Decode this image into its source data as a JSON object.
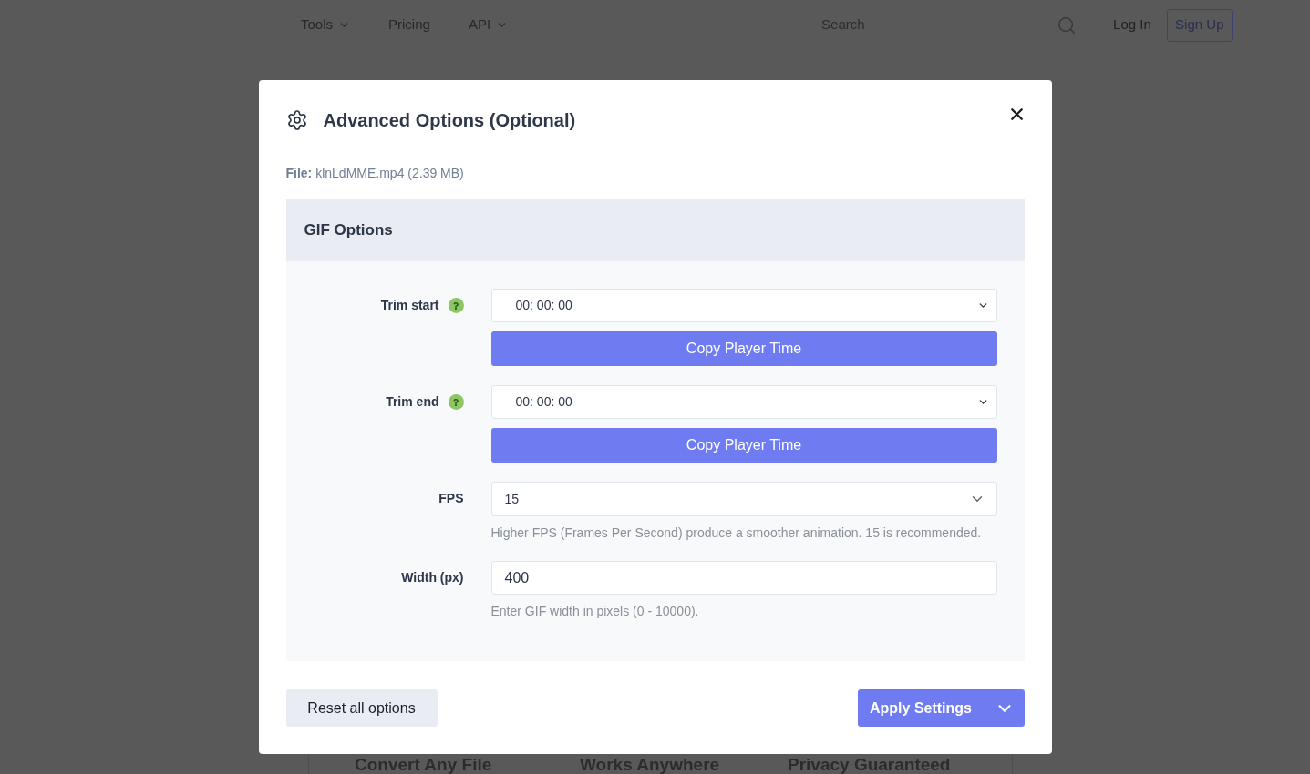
{
  "nav": {
    "links": [
      {
        "label": "Tools",
        "dropdown": true
      },
      {
        "label": "Pricing",
        "dropdown": false
      },
      {
        "label": "API",
        "dropdown": true
      }
    ],
    "search": {
      "placeholder": "Search"
    },
    "log_in": "Log In",
    "sign_up": "Sign Up"
  },
  "features": [
    "Convert Any File",
    "Works Anywhere",
    "Privacy Guaranteed"
  ],
  "dialog": {
    "title": "Advanced Options (Optional)",
    "file": "**File:** klnLdMME.mp4 (2.39 MB)",
    "section": {
      "title": "GIF Options",
      "fields": [
        {
          "kind": "time",
          "label": "Trim start",
          "help": true,
          "value": "00: 00: 00",
          "button": "Copy Player Time"
        },
        {
          "kind": "time",
          "label": "Trim end",
          "help": true,
          "value": "00: 00: 00",
          "button": "Copy Player Time"
        },
        {
          "kind": "select",
          "label": "FPS",
          "help": false,
          "value": "15",
          "hint": "Higher FPS (Frames Per Second) produce a smoother animation. 15 is recommended."
        },
        {
          "kind": "number",
          "label": "Width (px)",
          "help": false,
          "value": "400",
          "hint": "Enter GIF width in pixels (0 - 10000)."
        }
      ]
    },
    "reset_button": "Reset all options",
    "apply_button": "Apply Settings"
  }
}
